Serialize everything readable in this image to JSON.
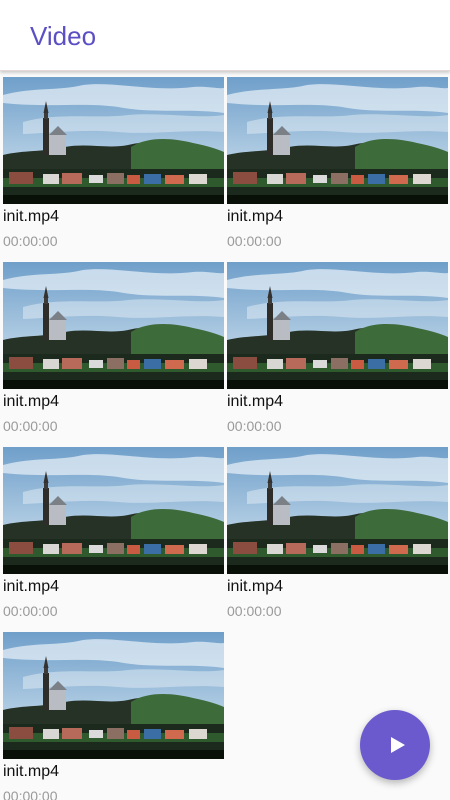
{
  "app_bar": {
    "title": "Video"
  },
  "videos": [
    {
      "title": "init.mp4",
      "duration": "00:00:00"
    },
    {
      "title": "init.mp4",
      "duration": "00:00:00"
    },
    {
      "title": "init.mp4",
      "duration": "00:00:00"
    },
    {
      "title": "init.mp4",
      "duration": "00:00:00"
    },
    {
      "title": "init.mp4",
      "duration": "00:00:00"
    },
    {
      "title": "init.mp4",
      "duration": "00:00:00"
    },
    {
      "title": "init.mp4",
      "duration": "00:00:00"
    }
  ],
  "fab": {
    "icon": "play-icon"
  },
  "colors": {
    "accent": "#6a5acd",
    "title_text": "#5b4fc4",
    "duration_text": "#9a9a9a"
  }
}
